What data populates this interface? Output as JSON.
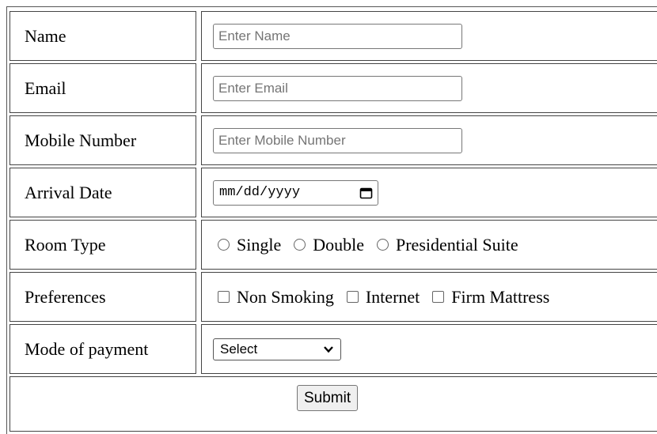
{
  "form": {
    "name": {
      "label": "Name",
      "placeholder": "Enter Name"
    },
    "email": {
      "label": "Email",
      "placeholder": "Enter Email"
    },
    "mobile": {
      "label": "Mobile Number",
      "placeholder": "Enter Mobile Number"
    },
    "arrival": {
      "label": "Arrival Date",
      "placeholder": "mm/dd/yyyy",
      "icon": "calendar-icon"
    },
    "room_type": {
      "label": "Room Type",
      "options": [
        "Single",
        "Double",
        "Presidential Suite"
      ]
    },
    "preferences": {
      "label": "Preferences",
      "options": [
        "Non Smoking",
        "Internet",
        "Firm Mattress"
      ]
    },
    "payment": {
      "label": "Mode of payment",
      "selected": "Select",
      "icon": "chevron-down-icon"
    },
    "submit_label": "Submit"
  }
}
